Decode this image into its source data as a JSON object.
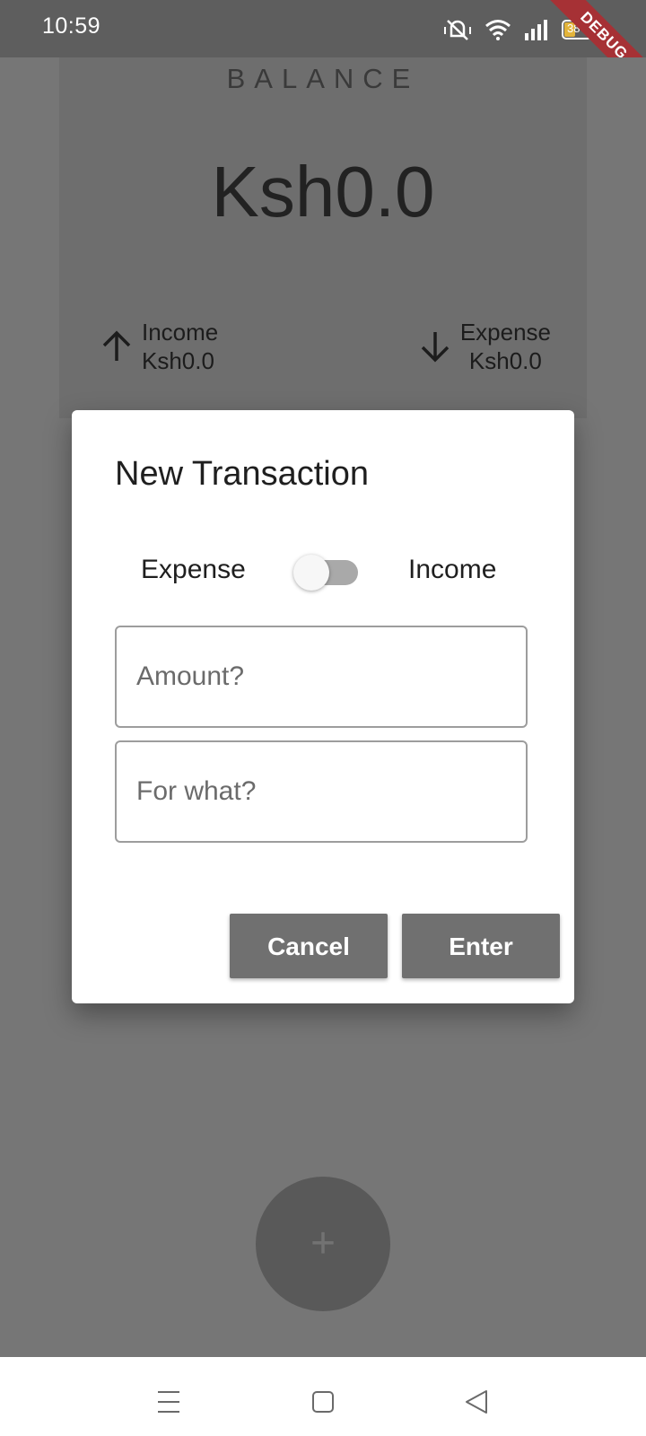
{
  "status_bar": {
    "time": "10:59",
    "battery": "38",
    "debug_banner": "DEBUG"
  },
  "balance": {
    "label": "BALANCE",
    "amount": "Ksh0.0",
    "income_label": "Income",
    "income_amount": "Ksh0.0",
    "expense_label": "Expense",
    "expense_amount": "Ksh0.0"
  },
  "fab": {
    "label": "+"
  },
  "dialog": {
    "title": "New Transaction",
    "toggle_left_label": "Expense",
    "toggle_right_label": "Income",
    "toggle_on": false,
    "amount_placeholder": "Amount?",
    "amount_value": "",
    "for_what_placeholder": "For what?",
    "for_what_value": "",
    "cancel_label": "Cancel",
    "enter_label": "Enter"
  },
  "nav_bar": {
    "icons": [
      "menu-icon",
      "home-square-icon",
      "back-triangle-icon"
    ]
  },
  "colors": {
    "scrim": "#767676",
    "dialog_bg": "#ffffff",
    "button_bg": "#707070",
    "debug_ribbon": "#a63135"
  }
}
